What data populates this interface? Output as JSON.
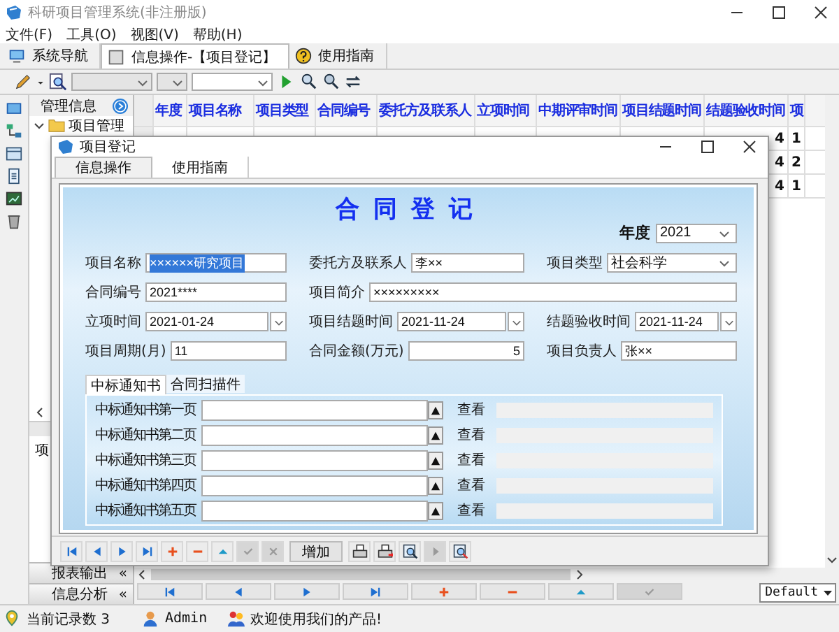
{
  "window": {
    "title": "科研项目管理系统(非注册版)"
  },
  "menu": [
    "文件(F)",
    "工具(O)",
    "视图(V)",
    "帮助(H)"
  ],
  "tabs": [
    {
      "label": "系统导航",
      "selected": false
    },
    {
      "label": "信息操作-【项目登记】",
      "selected": true
    },
    {
      "label": "使用指南",
      "selected": false
    }
  ],
  "sidebar": {
    "title": "管理信息",
    "tree": [
      {
        "label": "项目管理",
        "expanded": true
      }
    ],
    "panel_text": "项",
    "sections": [
      {
        "label": "报表输出",
        "toggle": "«"
      },
      {
        "label": "信息分析",
        "toggle": "«"
      }
    ]
  },
  "grid": {
    "columns": [
      "年度",
      "项目名称",
      "项目类型",
      "合同编号",
      "委托方及联系人",
      "立项时间",
      "中期评审时间",
      "项目结题时间",
      "结题验收时间",
      "项"
    ],
    "rows": [
      {
        "cells": [
          "4",
          "1"
        ]
      },
      {
        "cells": [
          "4",
          "2"
        ]
      },
      {
        "cells": [
          "4",
          "1"
        ]
      }
    ],
    "nav_buttons": [
      {
        "kind": "first",
        "disabled": false
      },
      {
        "kind": "prev",
        "disabled": false
      },
      {
        "kind": "next",
        "disabled": false
      },
      {
        "kind": "last",
        "disabled": false
      },
      {
        "kind": "add",
        "disabled": false
      },
      {
        "kind": "delete",
        "disabled": false
      },
      {
        "kind": "edit",
        "disabled": false
      },
      {
        "kind": "check",
        "disabled": true
      }
    ],
    "style_select": "Default"
  },
  "dialog": {
    "title": "项目登记",
    "tabs": [
      {
        "label": "信息操作",
        "selected": true
      },
      {
        "label": "使用指南",
        "selected": false
      }
    ],
    "heading": "合同登记",
    "year": {
      "label": "年度",
      "value": "2021"
    },
    "rows": [
      [
        {
          "label": "项目名称",
          "value": "××××××研究项目",
          "kind": "text",
          "highlighted": true
        },
        {
          "label": "委托方及联系人",
          "value": "李××",
          "kind": "text",
          "highlighted": false
        },
        {
          "label": "项目类型",
          "value": "社会科学",
          "kind": "select",
          "highlighted": false
        }
      ],
      [
        {
          "label": "合同编号",
          "value": "2021****",
          "kind": "text",
          "highlighted": false
        },
        {
          "label": "项目简介",
          "value": "×××××××××",
          "kind": "wide",
          "highlighted": false
        }
      ],
      [
        {
          "label": "立项时间",
          "value": "2021-01-24",
          "kind": "date",
          "highlighted": false
        },
        {
          "label": "项目结题时间",
          "value": "2021-11-24",
          "kind": "date",
          "highlighted": false
        },
        {
          "label": "结题验收时间",
          "value": "2021-11-24",
          "kind": "date",
          "highlighted": false
        }
      ],
      [
        {
          "label": "项目周期(月)",
          "value": "11",
          "kind": "text",
          "highlighted": false
        },
        {
          "label": "合同金额(万元)",
          "value": "5",
          "kind": "number",
          "highlighted": false
        },
        {
          "label": "项目负责人",
          "value": "张××",
          "kind": "text",
          "highlighted": false
        }
      ]
    ],
    "attachments": {
      "tabs": [
        {
          "label": "中标通知书",
          "selected": true
        },
        {
          "label": "合同扫描件",
          "selected": false
        }
      ],
      "rows": [
        {
          "label": "中标通知书第一页",
          "action": "查看"
        },
        {
          "label": "中标通知书第二页",
          "action": "查看"
        },
        {
          "label": "中标通知书第三页",
          "action": "查看"
        },
        {
          "label": "中标通知书第四页",
          "action": "查看"
        },
        {
          "label": "中标通知书第五页",
          "action": "查看"
        }
      ]
    },
    "toolbar": [
      {
        "kind": "first",
        "disabled": false
      },
      {
        "kind": "prev",
        "disabled": false
      },
      {
        "kind": "next",
        "disabled": false
      },
      {
        "kind": "last",
        "disabled": false
      },
      {
        "kind": "add",
        "disabled": false
      },
      {
        "kind": "delete",
        "disabled": false
      },
      {
        "kind": "edit",
        "disabled": false
      },
      {
        "kind": "check",
        "disabled": true
      },
      {
        "kind": "cancel",
        "disabled": true
      },
      {
        "kind": "text",
        "label": "增加",
        "disabled": false
      },
      {
        "kind": "print",
        "disabled": false
      },
      {
        "kind": "print-export",
        "disabled": false
      },
      {
        "kind": "preview",
        "disabled": false
      },
      {
        "kind": "next-page",
        "disabled": true
      },
      {
        "kind": "preview-report",
        "disabled": false
      }
    ]
  },
  "status_bar": {
    "record_count": "当前记录数 3",
    "user": "Admin",
    "message": "欢迎使用我们的产品!"
  }
}
